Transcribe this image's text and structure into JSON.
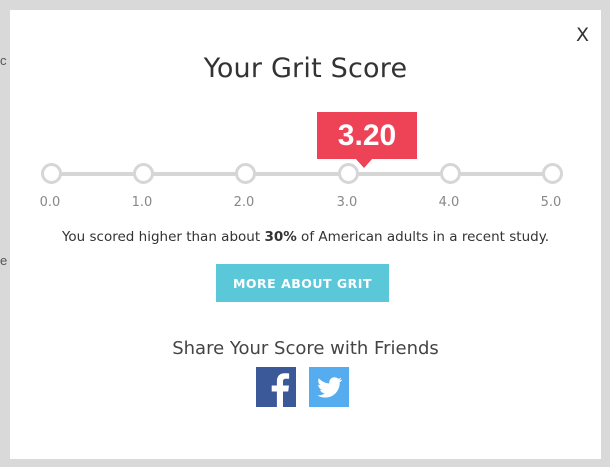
{
  "backdrop": {
    "fragment_1": "c",
    "fragment_2": "e"
  },
  "modal": {
    "close_label": "X",
    "title": "Your Grit Score",
    "score": "3.20",
    "score_value": 3.2,
    "scale_min": 0,
    "scale_max": 5,
    "scale_labels": [
      "0.0",
      "1.0",
      "2.0",
      "3.0",
      "4.0",
      "5.0"
    ],
    "result_prefix": "You scored higher than about ",
    "result_percent": "30%",
    "result_suffix": " of American adults in a recent study.",
    "more_button": "MORE ABOUT GRIT",
    "share_title": "Share Your Score with Friends",
    "share_icons": [
      "facebook-icon",
      "twitter-icon"
    ]
  },
  "colors": {
    "badge": "#ee4357",
    "button": "#5bc8da",
    "facebook": "#3b5998",
    "twitter": "#55acee"
  }
}
